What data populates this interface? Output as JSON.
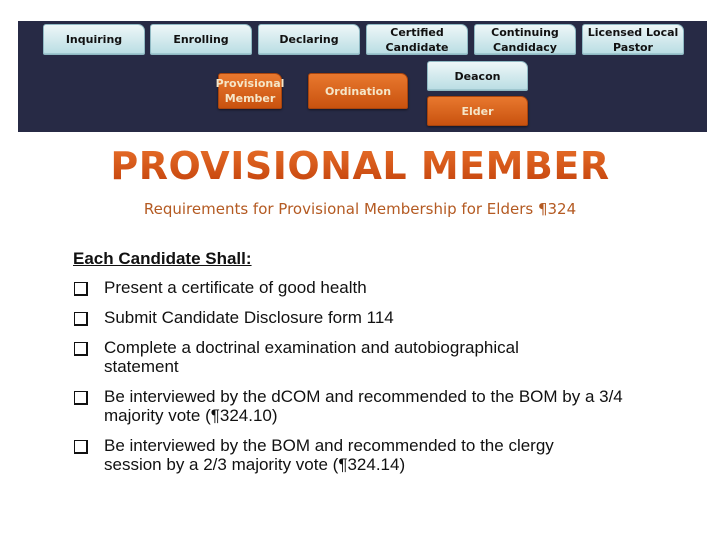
{
  "nav": {
    "top_row": [
      {
        "label": "Inquiring"
      },
      {
        "label": "Enrolling"
      },
      {
        "label": "Declaring"
      },
      {
        "label": "Certified Candidate"
      },
      {
        "label": "Continuing Candidacy"
      },
      {
        "label": "Licensed Local Pastor"
      }
    ],
    "provisional_member": "Provisional Member",
    "ordination": "Ordination",
    "deacon": "Deacon",
    "elder": "Elder",
    "colors": {
      "panel": "#272a45",
      "light_button": "#d6ecef",
      "active_button": "#d9621c"
    }
  },
  "title": "PROVISIONAL MEMBER",
  "subtitle": "Requirements for Provisional Membership for Elders ¶324",
  "heading": "Each Candidate Shall:",
  "requirements": [
    "Present a certificate of good health",
    "Submit Candidate Disclosure form 114",
    "Complete a doctrinal examination and autobiographical statement",
    "Be interviewed by the dCOM and recommended to the BOM by a 3/4 majority vote (¶324.10)",
    "Be interviewed by the BOM and recommended to the clergy session by a 2/3 majority vote (¶324.14)"
  ]
}
